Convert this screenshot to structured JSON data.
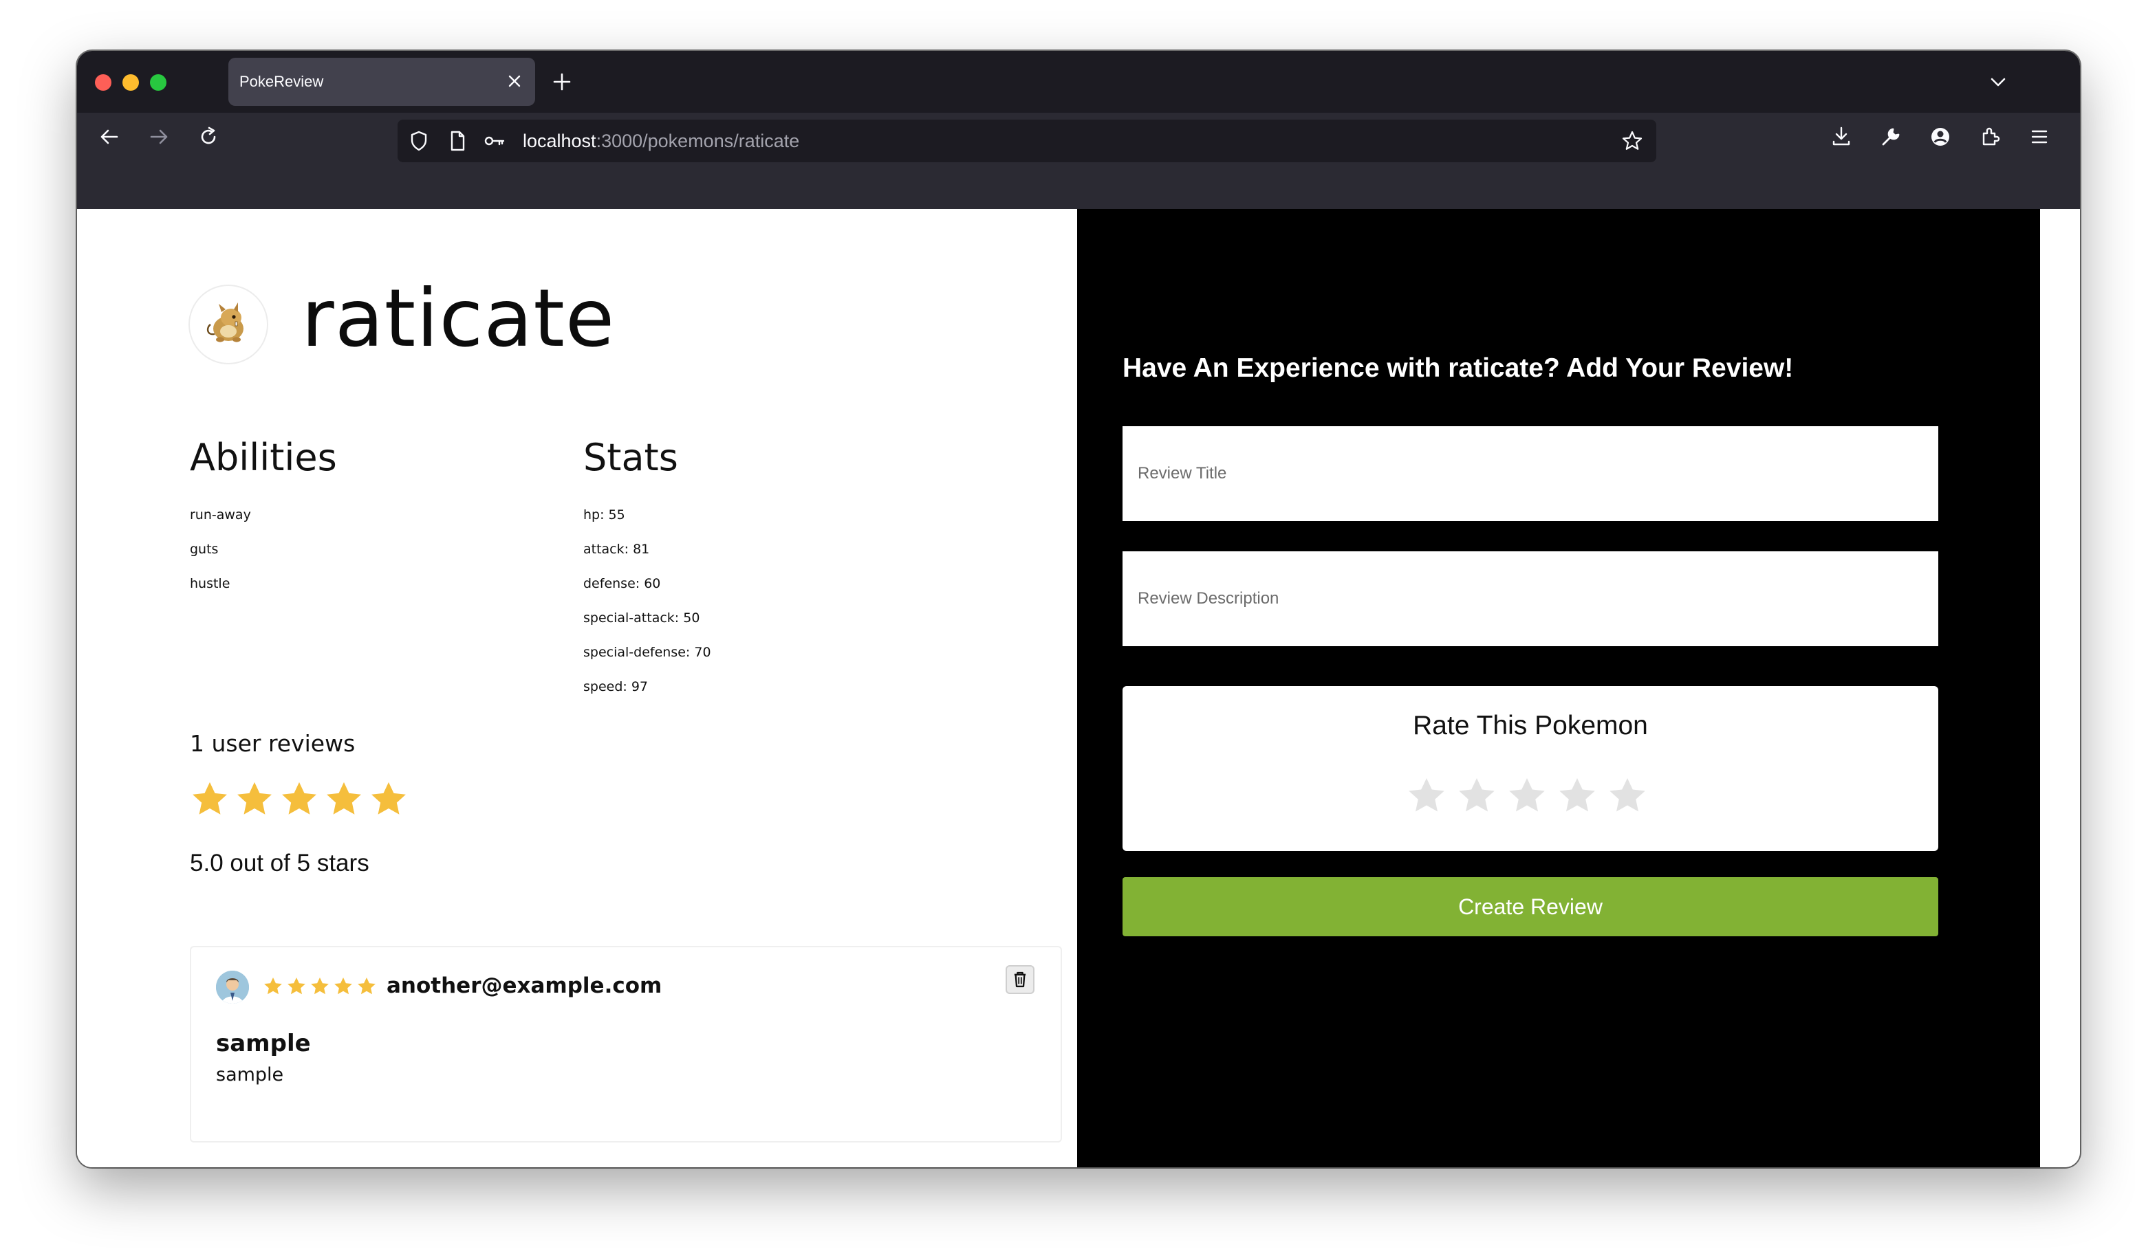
{
  "browser": {
    "tab_title": "PokeReview",
    "url_host": "localhost",
    "url_path": ":3000/pokemons/raticate"
  },
  "pokemon": {
    "name": "raticate",
    "abilities_heading": "Abilities",
    "abilities": [
      "run-away",
      "guts",
      "hustle"
    ],
    "stats_heading": "Stats",
    "stats": [
      "hp: 55",
      "attack: 81",
      "defense: 60",
      "special-attack: 50",
      "special-defense: 70",
      "speed: 97"
    ]
  },
  "summary": {
    "review_count_text": "1 user reviews",
    "average_rating": 5,
    "max_rating": 5,
    "average_text": "5.0 out of 5 stars"
  },
  "reviews": [
    {
      "author": "another@example.com",
      "rating": 5,
      "title": "sample",
      "body": "sample"
    }
  ],
  "form": {
    "heading": "Have An Experience with raticate? Add Your Review!",
    "title_placeholder": "Review Title",
    "description_placeholder": "Review Description",
    "rate_title": "Rate This Pokemon",
    "current_rating": 0,
    "submit_label": "Create Review"
  },
  "colors": {
    "star_filled": "#f5be3c",
    "star_empty": "#e2e2e2",
    "accent_green": "#82b234",
    "form_panel_bg": "#000000"
  },
  "icons": {
    "back": "arrow-left-icon",
    "forward": "arrow-right-icon",
    "reload": "reload-icon",
    "delete": "trash-icon"
  }
}
